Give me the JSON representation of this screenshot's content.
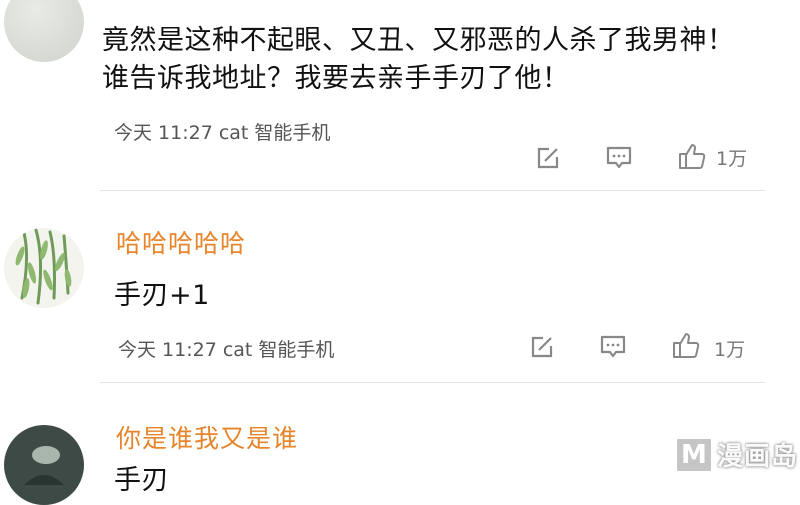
{
  "comments": [
    {
      "text_line1": "竟然是这种不起眼、又丑、又邪恶的人杀了我男神！",
      "text_line2": "谁告诉我地址？我要去亲手手刃了他！",
      "meta": "今天 11:27 cat 智能手机",
      "likes": "1万"
    },
    {
      "username": "哈哈哈哈哈",
      "text": "手刃+1",
      "meta": "今天 11:27 cat 智能手机",
      "likes": "1万"
    },
    {
      "username": "你是谁我又是谁",
      "text": "手刃"
    }
  ],
  "watermark": {
    "logo": "M",
    "text": "漫画岛"
  },
  "icons": {
    "edit": "edit-icon",
    "reply": "comment-icon",
    "like": "thumbs-up-icon"
  },
  "colors": {
    "username": "#e6852b",
    "meta": "#555555",
    "icon": "#888888"
  }
}
